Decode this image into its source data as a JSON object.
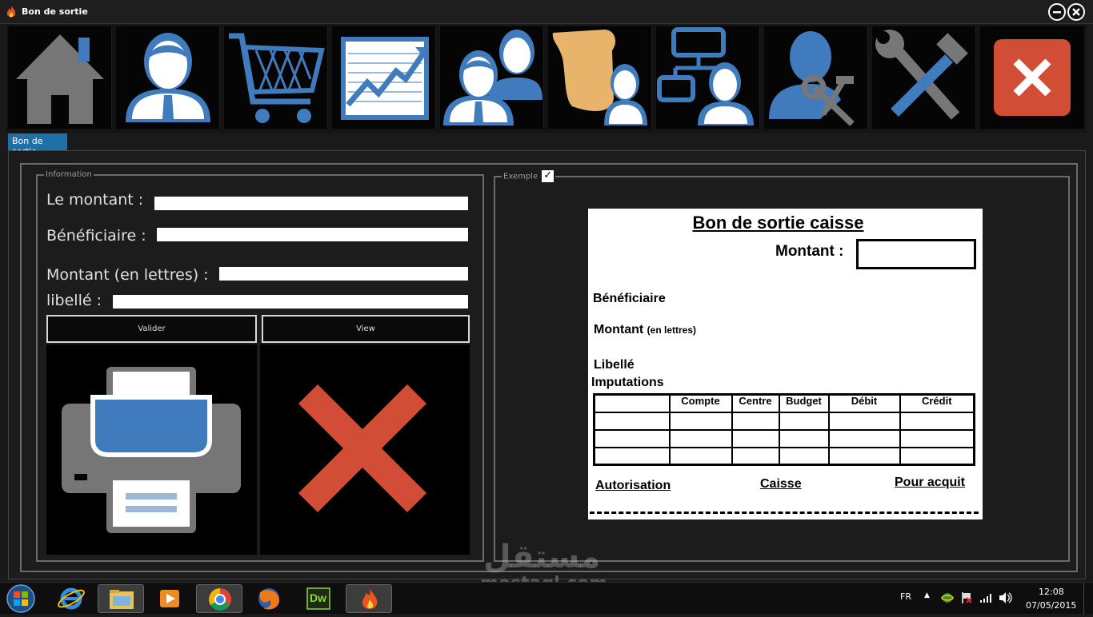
{
  "window": {
    "title": "Bon de sortie"
  },
  "toolbar": {
    "buttons": [
      {
        "name": "home-icon"
      },
      {
        "name": "user-icon"
      },
      {
        "name": "cart-icon"
      },
      {
        "name": "chart-icon"
      },
      {
        "name": "users-group-icon"
      },
      {
        "name": "scroll-user-icon"
      },
      {
        "name": "org-chart-icon"
      },
      {
        "name": "user-tools-icon"
      },
      {
        "name": "tools-icon"
      },
      {
        "name": "close-icon"
      }
    ]
  },
  "tab": {
    "label": "Bon de sortie"
  },
  "info": {
    "legend": "Information",
    "montant_label": "Le montant :",
    "beneficiaire_label": "Bénéficiaire :",
    "lettres_label": "Montant (en lettres) :",
    "libelle_label": "libellé :",
    "montant_value": "",
    "beneficiaire_value": "",
    "lettres_value": "",
    "libelle_value": "",
    "valider_label": "Valider",
    "view_label": "View"
  },
  "exemple": {
    "legend": "Exemple",
    "checked": true
  },
  "doc": {
    "title": "Bon de sortie caisse",
    "montant": "Montant :",
    "beneficiaire": "Bénéficiaire",
    "montant_lettres": "Montant",
    "en_lettres": "(en lettres)",
    "libelle": "Libellé",
    "imputations": "Imputations",
    "columns": [
      "",
      "Compte",
      "Centre",
      "Budget",
      "Débit",
      "Crédit"
    ],
    "autorisation": "Autorisation",
    "caisse": "Caisse",
    "pour_acquit": "Pour acquit"
  },
  "taskbar": {
    "lang": "FR",
    "time": "12:08",
    "date": "07/05/2015",
    "apps": [
      "ie-icon",
      "explorer-icon",
      "media-player-icon",
      "chrome-icon",
      "firefox-icon",
      "dreamweaver-icon",
      "flame-app-icon"
    ],
    "dw_label": "Dw"
  },
  "watermark": {
    "arabic": "مستقل",
    "latin": "mostaql.com"
  },
  "colors": {
    "accent_blue": "#3f7bbd",
    "red": "#d24d35",
    "tab_blue": "#1f6fa8"
  }
}
